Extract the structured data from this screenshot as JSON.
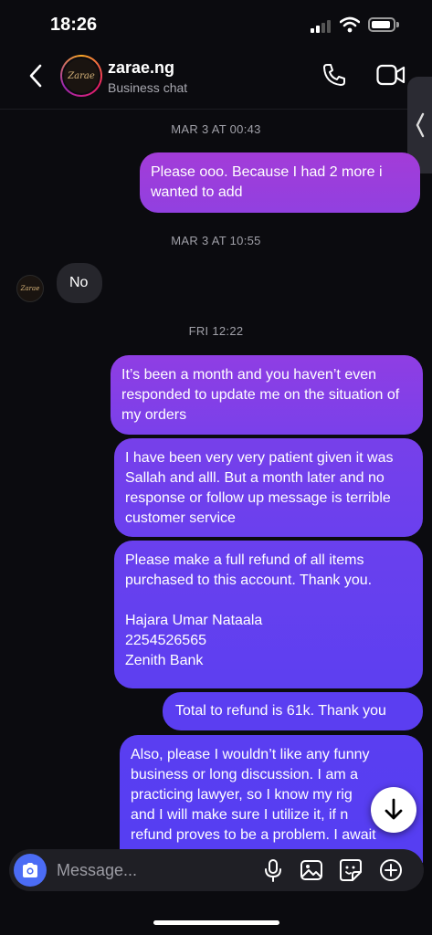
{
  "status": {
    "time": "18:26"
  },
  "header": {
    "name": "zarae.ng",
    "subtitle": "Business chat",
    "avatar_text": "Zarae"
  },
  "timestamps": [
    "MAR 3 AT 00:43",
    "MAR 3 AT 10:55",
    "FRI 12:22"
  ],
  "messages": [
    {
      "from": "me",
      "text": "Please ooo. Because I had 2 more i wanted to add"
    },
    {
      "from": "them",
      "text": "No"
    },
    {
      "from": "me",
      "text": "It’s been a month and you haven’t even responded to update me on the situation of my orders"
    },
    {
      "from": "me",
      "text": "I have been very very patient given it was Sallah and alll.  But a month later and no response or follow up message is terrible customer service"
    },
    {
      "from": "me",
      "text": "Please make a full refund of all items purchased to this account. Thank you.\n\nHajara Umar Nataala\n2254526565\nZenith Bank"
    },
    {
      "from": "me",
      "text": "Total to refund is 61k. Thank you"
    },
    {
      "from": "me",
      "text": "Also, please I wouldn’t like any funny business or long discussion. I am a practicing lawyer, so I know my rig\nand I will make sure I utilize it, if n\nrefund proves to be a problem. I await"
    }
  ],
  "composer": {
    "placeholder": "Message..."
  },
  "colors": {
    "bubble_top": "#a13fd6",
    "bubble_bottom": "#5b3df0",
    "incoming": "#26262c",
    "camera": "#4b6cf5"
  }
}
